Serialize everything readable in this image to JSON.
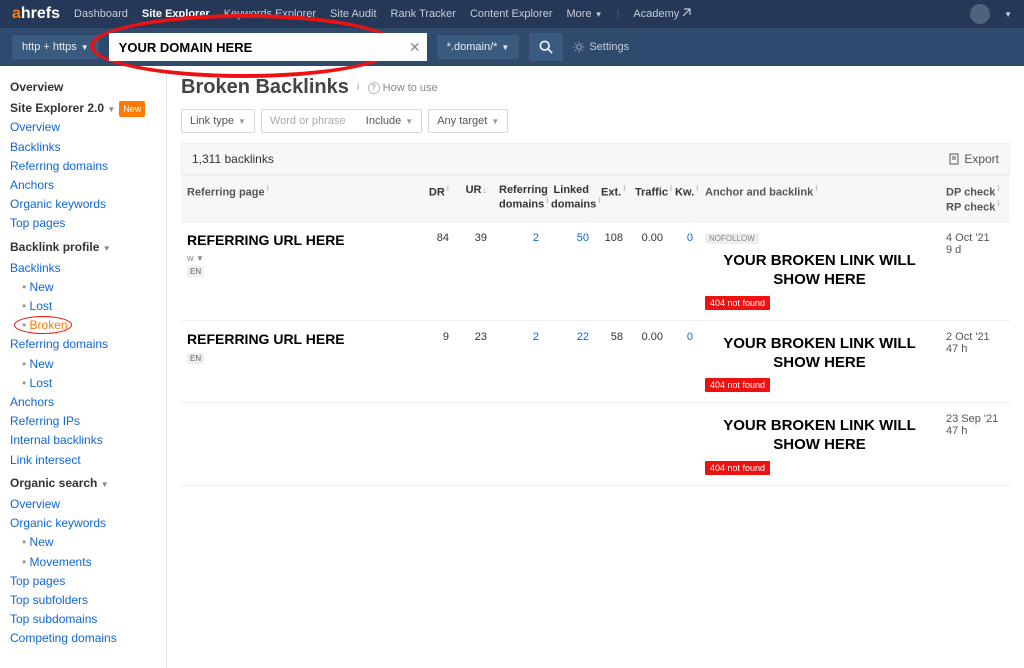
{
  "top": {
    "logo_prefix": "a",
    "logo_rest": "hrefs",
    "items": [
      "Dashboard",
      "Site Explorer",
      "Keywords Explorer",
      "Site Audit",
      "Rank Tracker",
      "Content Explorer",
      "More"
    ],
    "active_index": 1,
    "academy": "Academy"
  },
  "bar2": {
    "protocol": "http + https",
    "url_value": "YOUR DOMAIN HERE",
    "mode": "*.domain/*",
    "settings": "Settings"
  },
  "sidebar": {
    "overview_hdr": "Overview",
    "se2": "Site Explorer 2.0",
    "new_badge": "New",
    "items1": [
      "Overview",
      "Backlinks",
      "Referring domains",
      "Anchors",
      "Organic keywords",
      "Top pages"
    ],
    "backlink_hdr": "Backlink profile",
    "backlinks": "Backlinks",
    "bl_sub": [
      "New",
      "Lost",
      "Broken"
    ],
    "refdom": "Referring domains",
    "rd_sub": [
      "New",
      "Lost"
    ],
    "items2": [
      "Anchors",
      "Referring IPs",
      "Internal backlinks",
      "Link intersect"
    ],
    "organic_hdr": "Organic search",
    "organic_items": [
      "Overview",
      "Organic keywords"
    ],
    "ok_sub": [
      "New",
      "Movements"
    ],
    "items3": [
      "Top pages",
      "Top subfolders",
      "Top subdomains",
      "Competing domains"
    ]
  },
  "page": {
    "title": "Broken Backlinks",
    "how": "How to use",
    "filters": {
      "linktype": "Link type",
      "word": "Word or phrase",
      "include": "Include",
      "anytarget": "Any target"
    },
    "count": "1,311 backlinks",
    "export": "Export"
  },
  "table": {
    "headers": {
      "ref": "Referring page",
      "dr": "DR",
      "ur": "UR",
      "rd": "Referring domains",
      "ld": "Linked domains",
      "ext": "Ext.",
      "traffic": "Traffic",
      "kw": "Kw.",
      "anchor": "Anchor and backlink",
      "dp": "DP check",
      "rp": "RP check"
    },
    "rows": [
      {
        "ref": "REFERRING URL HERE",
        "sub": "w",
        "lang": "EN",
        "dr": "84",
        "ur": "39",
        "rd": "2",
        "ld": "50",
        "ext": "108",
        "traffic": "0.00",
        "kw": "0",
        "nofollow": "NOFOLLOW",
        "broken": "YOUR BROKEN LINK WILL SHOW HERE",
        "err": "404 not found",
        "date": "4 Oct '21",
        "age": "9 d"
      },
      {
        "ref": "REFERRING URL HERE",
        "sub": "",
        "lang": "EN",
        "dr": "9",
        "ur": "23",
        "rd": "2",
        "ld": "22",
        "ext": "58",
        "traffic": "0.00",
        "kw": "0",
        "nofollow": "",
        "broken": "YOUR BROKEN LINK WILL SHOW HERE",
        "err": "404 not found",
        "date": "2 Oct '21",
        "age": "47 h"
      },
      {
        "ref": "",
        "sub": "",
        "lang": "",
        "dr": "",
        "ur": "",
        "rd": "",
        "ld": "",
        "ext": "",
        "traffic": "",
        "kw": "",
        "nofollow": "",
        "broken": "YOUR BROKEN LINK WILL SHOW HERE",
        "err": "404 not found",
        "date": "23 Sep '21",
        "age": "47 h"
      }
    ]
  }
}
